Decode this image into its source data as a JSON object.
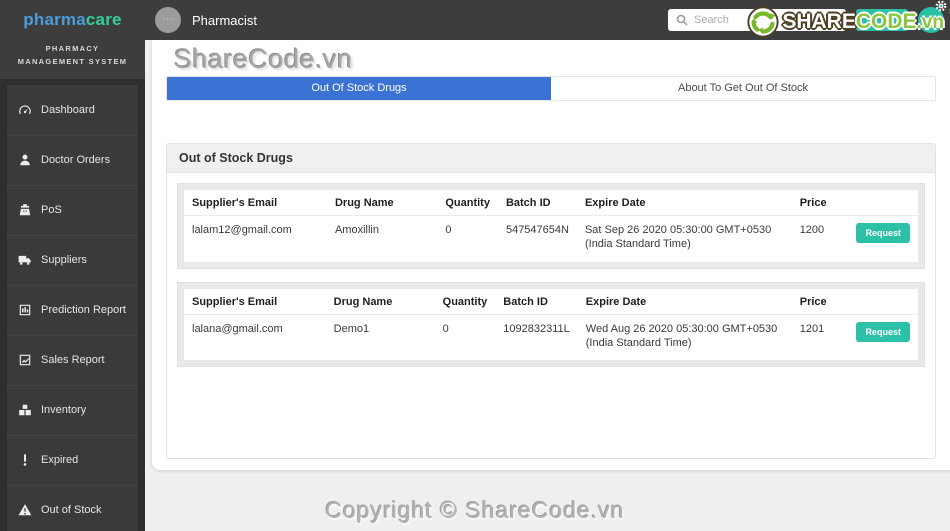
{
  "brand": {
    "name_part1": "pharma",
    "name_part2": "care",
    "subtitle": "PHARMACY MANAGEMENT SYSTEM"
  },
  "topbar": {
    "user_label": "Pharmacist",
    "search_placeholder": "Search"
  },
  "sidebar": {
    "items": [
      {
        "label": "Dashboard",
        "icon": "dashboard-icon"
      },
      {
        "label": "Doctor Orders",
        "icon": "doctor-orders-icon"
      },
      {
        "label": "PoS",
        "icon": "pos-icon"
      },
      {
        "label": "Suppliers",
        "icon": "suppliers-icon"
      },
      {
        "label": "Prediction Report",
        "icon": "prediction-report-icon"
      },
      {
        "label": "Sales Report",
        "icon": "sales-report-icon"
      },
      {
        "label": "Inventory",
        "icon": "inventory-icon"
      },
      {
        "label": "Expired",
        "icon": "expired-icon"
      },
      {
        "label": "Out of Stock",
        "icon": "out-of-stock-icon"
      }
    ]
  },
  "tabs": {
    "active": "Out Of Stock Drugs",
    "inactive": "About To Get Out Of Stock"
  },
  "panel": {
    "title": "Out of Stock Drugs"
  },
  "table": {
    "headers": [
      "Supplier's Email",
      "Drug Name",
      "Quantity",
      "Batch ID",
      "Expire Date",
      "Price"
    ],
    "action_label": "Request"
  },
  "tables": [
    {
      "rows": [
        {
          "email": "lalam12@gmail.com",
          "drug": "Amoxillin",
          "qty": "0",
          "batch": "547547654N",
          "expire": "Sat Sep 26 2020 05:30:00 GMT+0530 (India Standard Time)",
          "price": "1200"
        }
      ]
    },
    {
      "rows": [
        {
          "email": "lalana@gmail.com",
          "drug": "Demo1",
          "qty": "0",
          "batch": "1092832311L",
          "expire": "Wed Aug 26 2020 05:30:00 GMT+0530 (India Standard Time)",
          "price": "1201"
        }
      ]
    }
  ],
  "watermarks": {
    "top": "ShareCode.vn",
    "bottom": "Copyright © ShareCode.vn",
    "logo_share": "SHARE",
    "logo_code": "CODE",
    "logo_vn": ".vn"
  },
  "colors": {
    "accent_teal": "#2cc0a7",
    "tab_active_blue": "#3b73d4",
    "brand_blue": "#4b9cd9",
    "brand_green": "#35cf97",
    "sharecode_green": "#8dc63f",
    "topbar_bg": "#3d3d3d",
    "sidebar_bg": "#2e2e2e"
  }
}
